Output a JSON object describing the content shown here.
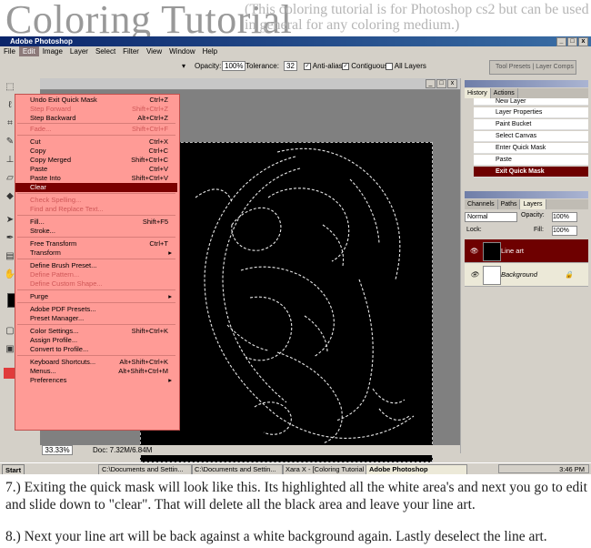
{
  "header": {
    "title": "Coloring Tutorial",
    "subtitle": "(This coloring tutorial is for Photoshop cs2 but can be used in general for any coloring medium.)"
  },
  "window": {
    "title": "Adobe Photoshop"
  },
  "menubar": [
    "File",
    "Edit",
    "Image",
    "Layer",
    "Select",
    "Filter",
    "View",
    "Window",
    "Help"
  ],
  "options": {
    "opacity_label": "Opacity:",
    "opacity_value": "100%",
    "tolerance_label": "Tolerance:",
    "tolerance_value": "32",
    "antialias": "Anti-alias",
    "contiguous": "Contiguous",
    "all_layers": "All Layers",
    "tool_tabs": "Tool Presets | Layer Comps"
  },
  "edit_menu": {
    "items": [
      {
        "label": "Undo Exit Quick Mask",
        "shortcut": "Ctrl+Z"
      },
      {
        "label": "Step Forward",
        "shortcut": "Shift+Ctrl+Z",
        "disabled": true
      },
      {
        "label": "Step Backward",
        "shortcut": "Alt+Ctrl+Z"
      },
      {
        "label": "Fade...",
        "shortcut": "Shift+Ctrl+F",
        "disabled": true
      },
      {
        "label": "Cut",
        "shortcut": "Ctrl+X"
      },
      {
        "label": "Copy",
        "shortcut": "Ctrl+C"
      },
      {
        "label": "Copy Merged",
        "shortcut": "Shift+Ctrl+C"
      },
      {
        "label": "Paste",
        "shortcut": "Ctrl+V"
      },
      {
        "label": "Paste Into",
        "shortcut": "Shift+Ctrl+V"
      },
      {
        "label": "Clear",
        "shortcut": "",
        "highlighted": true
      },
      {
        "label": "Check Spelling...",
        "shortcut": "",
        "disabled": true
      },
      {
        "label": "Find and Replace Text...",
        "shortcut": "",
        "disabled": true
      },
      {
        "label": "Fill...",
        "shortcut": "Shift+F5"
      },
      {
        "label": "Stroke...",
        "shortcut": ""
      },
      {
        "label": "Free Transform",
        "shortcut": "Ctrl+T"
      },
      {
        "label": "Transform",
        "shortcut": "",
        "submenu": true
      },
      {
        "label": "Define Brush Preset...",
        "shortcut": ""
      },
      {
        "label": "Define Pattern...",
        "shortcut": "",
        "disabled": true
      },
      {
        "label": "Define Custom Shape...",
        "shortcut": "",
        "disabled": true
      },
      {
        "label": "Purge",
        "shortcut": "",
        "submenu": true
      },
      {
        "label": "Adobe PDF Presets...",
        "shortcut": ""
      },
      {
        "label": "Preset Manager...",
        "shortcut": ""
      },
      {
        "label": "Color Settings...",
        "shortcut": "Shift+Ctrl+K"
      },
      {
        "label": "Assign Profile...",
        "shortcut": ""
      },
      {
        "label": "Convert to Profile...",
        "shortcut": ""
      },
      {
        "label": "Keyboard Shortcuts...",
        "shortcut": "Alt+Shift+Ctrl+K"
      },
      {
        "label": "Menus...",
        "shortcut": "Alt+Shift+Ctrl+M"
      },
      {
        "label": "Preferences",
        "shortcut": "",
        "submenu": true
      }
    ]
  },
  "history": {
    "tabs": [
      "History",
      "Actions"
    ],
    "items": [
      "New Layer",
      "Layer Properties",
      "Paint Bucket",
      "Select Canvas",
      "Enter Quick Mask",
      "Paste",
      "Exit Quick Mask"
    ]
  },
  "layers": {
    "tabs": [
      "Channels",
      "Paths",
      "Layers"
    ],
    "blend_mode": "Normal",
    "opacity_label": "Opacity:",
    "opacity_value": "100%",
    "lock_label": "Lock:",
    "fill_label": "Fill:",
    "fill_value": "100%",
    "items": [
      {
        "name": "Line art",
        "selected": true
      },
      {
        "name": "Background",
        "selected": false
      }
    ]
  },
  "status": {
    "zoom": "33.33%",
    "doc": "Doc: 7.32M/6.84M"
  },
  "taskbar": {
    "start": "Start",
    "tasks": [
      "C:\\Documents and Settin...",
      "C:\\Documents and Settin...",
      "Xara X - [Coloring Tutorial *]",
      "Adobe Photoshop"
    ],
    "time": "3:46 PM"
  },
  "caption": {
    "p1": "7.) Exiting the quick mask will look like this. Its highlighted all the white area's and next you go to edit and slide down to \"clear\". That will delete all the black area and leave your line art.",
    "p2": "8.) Next your line art will be back against a white background again. Lastly deselect the line art."
  }
}
